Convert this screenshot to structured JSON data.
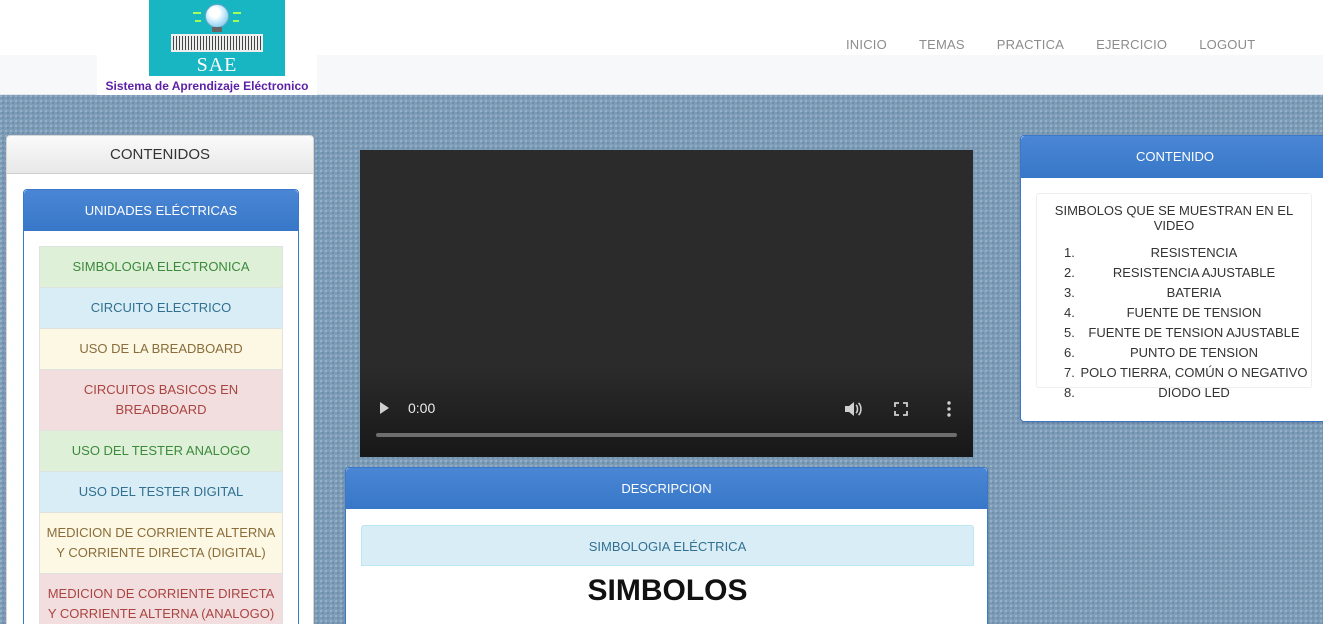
{
  "brand": {
    "logo_text": "SAE",
    "name": "Sistema de Aprendizaje Eléctronico"
  },
  "nav": {
    "items": [
      "INICIO",
      "TEMAS",
      "PRACTICA",
      "EJERCICIO",
      "LOGOUT"
    ]
  },
  "left_panel": {
    "title": "CONTENIDOS",
    "units_title": "UNIDADES ELÉCTRICAS",
    "items": [
      {
        "label": "SIMBOLOGIA ELECTRONICA",
        "style": "green"
      },
      {
        "label": "CIRCUITO ELECTRICO",
        "style": "blue"
      },
      {
        "label": "USO DE LA BREADBOARD",
        "style": "yellow"
      },
      {
        "label": "CIRCUITOS BASICOS EN BREADBOARD",
        "style": "red"
      },
      {
        "label": "USO DEL TESTER ANALOGO",
        "style": "green"
      },
      {
        "label": "USO DEL TESTER DIGITAL",
        "style": "blue"
      },
      {
        "label": "MEDICION DE CORRIENTE ALTERNA Y CORRIENTE DIRECTA (DIGITAL)",
        "style": "yellow"
      },
      {
        "label": "MEDICION DE CORRIENTE DIRECTA Y CORRIENTE ALTERNA (ANALOGO)",
        "style": "red"
      }
    ]
  },
  "video": {
    "time": "0:00",
    "progress": 0,
    "controls": [
      "play-icon",
      "volume-icon",
      "fullscreen-icon",
      "more-options-icon"
    ]
  },
  "description": {
    "title": "DESCRIPCION",
    "subtitle": "SIMBOLOGIA ELÉCTRICA",
    "heading": "SIMBOLOS"
  },
  "right_panel": {
    "title": "CONTENIDO",
    "box_title": "SIMBOLOS QUE SE MUESTRAN EN EL VIDEO",
    "items": [
      {
        "num": "1.",
        "label": "RESISTENCIA"
      },
      {
        "num": "2.",
        "label": "RESISTENCIA AJUSTABLE"
      },
      {
        "num": "3.",
        "label": "BATERIA"
      },
      {
        "num": "4.",
        "label": "FUENTE DE TENSION"
      },
      {
        "num": "5.",
        "label": "FUENTE DE TENSION AJUSTABLE"
      },
      {
        "num": "6.",
        "label": "PUNTO DE TENSION"
      },
      {
        "num": "7.",
        "label": "POLO TIERRA, COMÚN O NEGATIVO"
      },
      {
        "num": "8.",
        "label": "DIODO LED"
      }
    ]
  },
  "colors": {
    "accent_blue": "#3877c8",
    "brand_teal": "#18b5c3",
    "brand_purple": "#5b1fa6",
    "page_bg": "#7d9cb8"
  }
}
